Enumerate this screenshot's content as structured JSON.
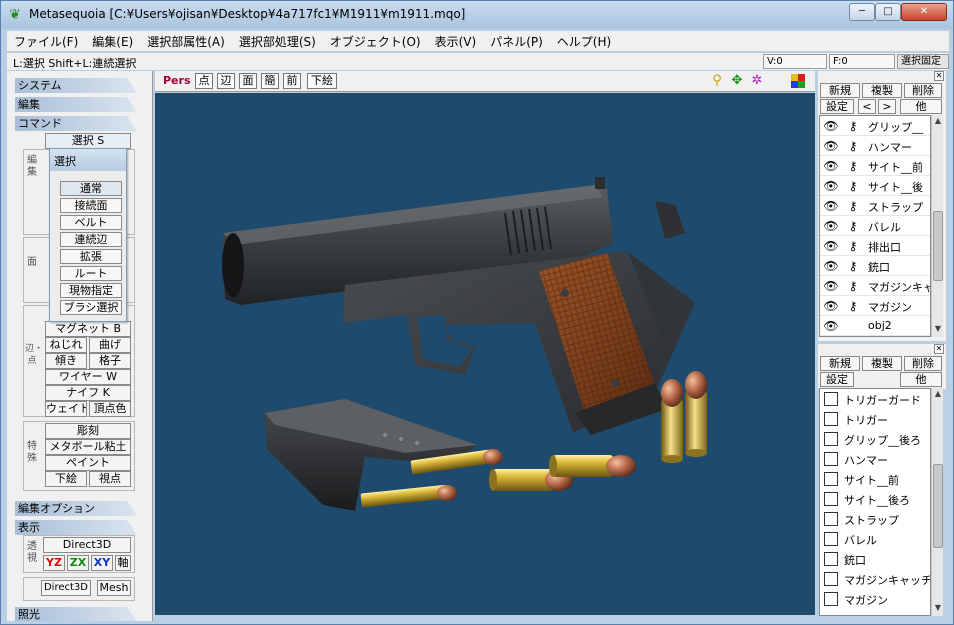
{
  "window": {
    "title": "Metasequoia [C:¥Users¥ojisan¥Desktop¥4a717fc1¥M1911¥m1911.mqo]",
    "app_icon": "leaf-icon",
    "min_glyph": "─",
    "max_glyph": "□",
    "close_glyph": "✕"
  },
  "menu": [
    "ファイル(F)",
    "編集(E)",
    "選択部属性(A)",
    "選択部処理(S)",
    "オブジェクト(O)",
    "表示(V)",
    "パネル(P)",
    "ヘルプ(H)"
  ],
  "status": {
    "hint": "L:選択  Shift+L:連続選択",
    "vertex_count": "V:0",
    "face_count": "F:0",
    "lock_label": "選択固定"
  },
  "left": {
    "system": "システム",
    "edit": "編集",
    "command": "コマンド",
    "select_btn": "選択 S",
    "group_edit": "編集",
    "group_face": "面",
    "group_edge": "辺・点",
    "group_special": "特殊",
    "magnet": "マグネット B",
    "twist": "ねじれ",
    "bend": "曲げ",
    "tilt": "傾き",
    "lattice": "格子",
    "wire": "ワイヤー W",
    "knife": "ナイフ K",
    "weight": "ウェイト",
    "vertex_color": "頂点色",
    "carve": "彫刻",
    "metaball": "メタボール粘土",
    "paint": "ペイント",
    "underlay": "下絵",
    "viewpoint": "視点",
    "edit_options": "編集オプション",
    "display": "表示",
    "perspective": "透視",
    "direct3d": "Direct3D",
    "yz": "YZ",
    "zx": "ZX",
    "xy": "XY",
    "axis": "軸",
    "direct3d_small": "Direct3D",
    "mesh": "Mesh",
    "lighting": "照光"
  },
  "select_palette": {
    "title": "選択",
    "options": [
      "通常",
      "接続面",
      "ベルト",
      "連続辺",
      "拡張",
      "ルート",
      "現物指定",
      "ブラシ選択"
    ]
  },
  "view": {
    "mode": "Pers",
    "point": "点",
    "edge": "辺",
    "face": "面",
    "simple": "簡",
    "front": "前",
    "underlay": "下絵"
  },
  "object_panel": {
    "new": "新規",
    "dup": "複製",
    "del": "削除",
    "settings": "設定",
    "prev": "<",
    "next": ">",
    "other": "他",
    "objects": [
      "グリップ__",
      "ハンマー",
      "サイト__前",
      "サイト__後",
      "ストラップ",
      "バレル",
      "排出口",
      "銃口",
      "マガジンキャ",
      "マガジン",
      "obj2"
    ]
  },
  "material_panel": {
    "new": "新規",
    "dup": "複製",
    "del": "削除",
    "settings": "設定",
    "other": "他",
    "materials": [
      "トリガーガード",
      "トリガー",
      "グリップ__後ろ",
      "ハンマー",
      "サイト__前",
      "サイト__後ろ",
      "ストラップ",
      "バレル",
      "銃口",
      "マガジンキャッチ",
      "マガジン"
    ]
  },
  "colors": {
    "viewport_bg": "#1e4a6e",
    "gun_metal": "#3a3d40",
    "grip_wood": "#7a3e1c",
    "brass": "#c9a52a",
    "copper": "#b86a4a",
    "mode_text": "#a0003c"
  }
}
